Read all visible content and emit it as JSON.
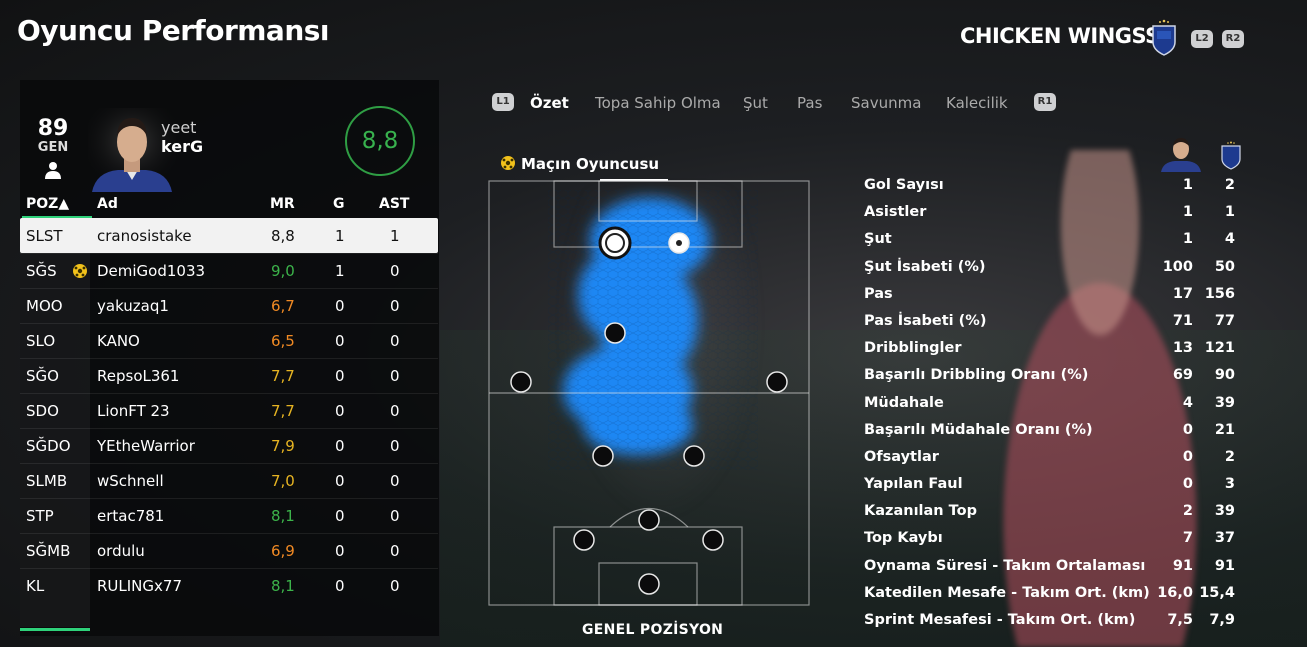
{
  "header": {
    "title": "Oyuncu Performansı",
    "team_name": "CHICKEN WINGSS",
    "l2": "L2",
    "r2": "R2"
  },
  "player": {
    "overall": "89",
    "overall_label": "GEN",
    "name_line1": "yeet",
    "name_line2": "kerG",
    "match_rating": "8,8"
  },
  "table": {
    "headers": {
      "poz": "POZ▲",
      "ad": "Ad",
      "mr": "MR",
      "g": "G",
      "ast": "AST"
    },
    "rows": [
      {
        "poz": "SLST",
        "ad": "cranosistake",
        "mr": "8,8",
        "g": "1",
        "ast": "1",
        "color": "#111111",
        "selected": true
      },
      {
        "poz": "SĞS",
        "ad": "DemiGod1033",
        "mr": "9,0",
        "g": "1",
        "ast": "0",
        "color": "#3cb34a",
        "motm": true
      },
      {
        "poz": "MOO",
        "ad": "yakuzaq1",
        "mr": "6,7",
        "g": "0",
        "ast": "0",
        "color": "#f08a24"
      },
      {
        "poz": "SLO",
        "ad": "KANO",
        "mr": "6,5",
        "g": "0",
        "ast": "0",
        "color": "#f08a24"
      },
      {
        "poz": "SĞO",
        "ad": "RepsoL361",
        "mr": "7,7",
        "g": "0",
        "ast": "0",
        "color": "#e6b422"
      },
      {
        "poz": "SDO",
        "ad": "LionFT 23",
        "mr": "7,7",
        "g": "0",
        "ast": "0",
        "color": "#e6b422"
      },
      {
        "poz": "SĞDO",
        "ad": "YEtheWarrior",
        "mr": "7,9",
        "g": "0",
        "ast": "0",
        "color": "#e6b422"
      },
      {
        "poz": "SLMB",
        "ad": "wSchnell",
        "mr": "7,0",
        "g": "0",
        "ast": "0",
        "color": "#e6b422"
      },
      {
        "poz": "STP",
        "ad": "ertac781",
        "mr": "8,1",
        "g": "0",
        "ast": "0",
        "color": "#3cb34a"
      },
      {
        "poz": "SĞMB",
        "ad": "ordulu",
        "mr": "6,9",
        "g": "0",
        "ast": "0",
        "color": "#f08a24"
      },
      {
        "poz": "KL",
        "ad": "RULINGx77",
        "mr": "8,1",
        "g": "0",
        "ast": "0",
        "color": "#3cb34a"
      }
    ]
  },
  "tabs": {
    "l1": "L1",
    "r1": "R1",
    "items": [
      "Özet",
      "Topa Sahip Olma",
      "Şut",
      "Pas",
      "Savunma",
      "Kalecilik"
    ],
    "active_index": 0
  },
  "pitch": {
    "motm_label": "Maçın Oyuncusu",
    "position_label": "GENEL POZİSYON"
  },
  "stats": [
    {
      "label": "Gol Sayısı",
      "player": "1",
      "team": "2"
    },
    {
      "label": "Asistler",
      "player": "1",
      "team": "1"
    },
    {
      "label": "Şut",
      "player": "1",
      "team": "4"
    },
    {
      "label": "Şut İsabeti (%)",
      "player": "100",
      "team": "50"
    },
    {
      "label": "Pas",
      "player": "17",
      "team": "156"
    },
    {
      "label": "Pas İsabeti (%)",
      "player": "71",
      "team": "77"
    },
    {
      "label": "Dribblingler",
      "player": "13",
      "team": "121"
    },
    {
      "label": "Başarılı Dribbling Oranı (%)",
      "player": "69",
      "team": "90"
    },
    {
      "label": "Müdahale",
      "player": "4",
      "team": "39"
    },
    {
      "label": "Başarılı Müdahale Oranı (%)",
      "player": "0",
      "team": "21"
    },
    {
      "label": "Ofsaytlar",
      "player": "0",
      "team": "2"
    },
    {
      "label": "Yapılan Faul",
      "player": "0",
      "team": "3"
    },
    {
      "label": "Kazanılan Top",
      "player": "2",
      "team": "39"
    },
    {
      "label": "Top Kaybı",
      "player": "7",
      "team": "37"
    },
    {
      "label": "Oynama Süresi - Takım Ortalaması",
      "player": "91",
      "team": "91"
    },
    {
      "label": "Katedilen Mesafe - Takım Ort. (km)",
      "player": "16,0",
      "team": "15,4"
    },
    {
      "label": "Sprint Mesafesi - Takım Ort. (km)",
      "player": "7,5",
      "team": "7,9"
    }
  ],
  "colors": {
    "accent_green": "#2fd27a",
    "heatmap_blue": "#1a8cff",
    "rating_ring": "#2f9e44"
  }
}
